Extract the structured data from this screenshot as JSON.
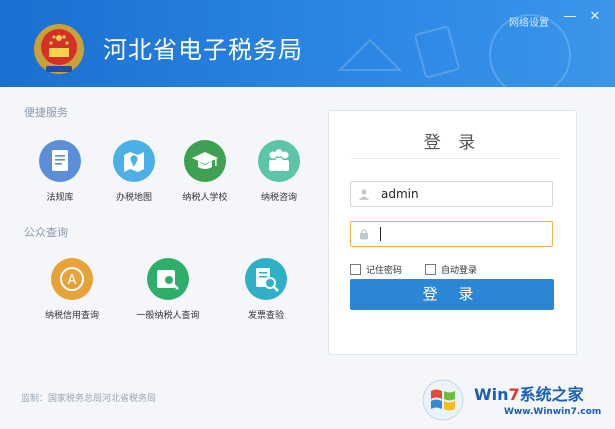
{
  "header": {
    "title": "河北省电子税务局",
    "network_settings": "网络设置",
    "minimize": "—",
    "close": "✕"
  },
  "convenience": {
    "title": "便捷服务",
    "items": [
      {
        "label": "法规库",
        "icon": "book-icon",
        "color": "#5b8ed6"
      },
      {
        "label": "办税地图",
        "icon": "map-icon",
        "color": "#4ab0e6"
      },
      {
        "label": "纳税人学校",
        "icon": "graduation-cap-icon",
        "color": "#3f9f52"
      },
      {
        "label": "纳税咨询",
        "icon": "people-icon",
        "color": "#5cc4a8"
      }
    ]
  },
  "public_query": {
    "title": "公众查询",
    "items": [
      {
        "label": "纳税信用查询",
        "icon": "credit-badge-icon",
        "color": "#e8a23a"
      },
      {
        "label": "一般纳税人查询",
        "icon": "taxpayer-search-icon",
        "color": "#2fae6b"
      },
      {
        "label": "发票查验",
        "icon": "invoice-search-icon",
        "color": "#2fb0c6"
      }
    ]
  },
  "footer": {
    "supervise": "监制：国家税务总局河北省税务局"
  },
  "login": {
    "title": "登 录",
    "username_value": "admin",
    "password_value": "",
    "remember_label": "记住密码",
    "autologin_label": "自动登录",
    "submit_label": "登 录"
  },
  "watermark": {
    "title_prefix": "Win",
    "title_seven": "7",
    "title_suffix": "系统之家",
    "url": "Www.Winwin7.com"
  }
}
